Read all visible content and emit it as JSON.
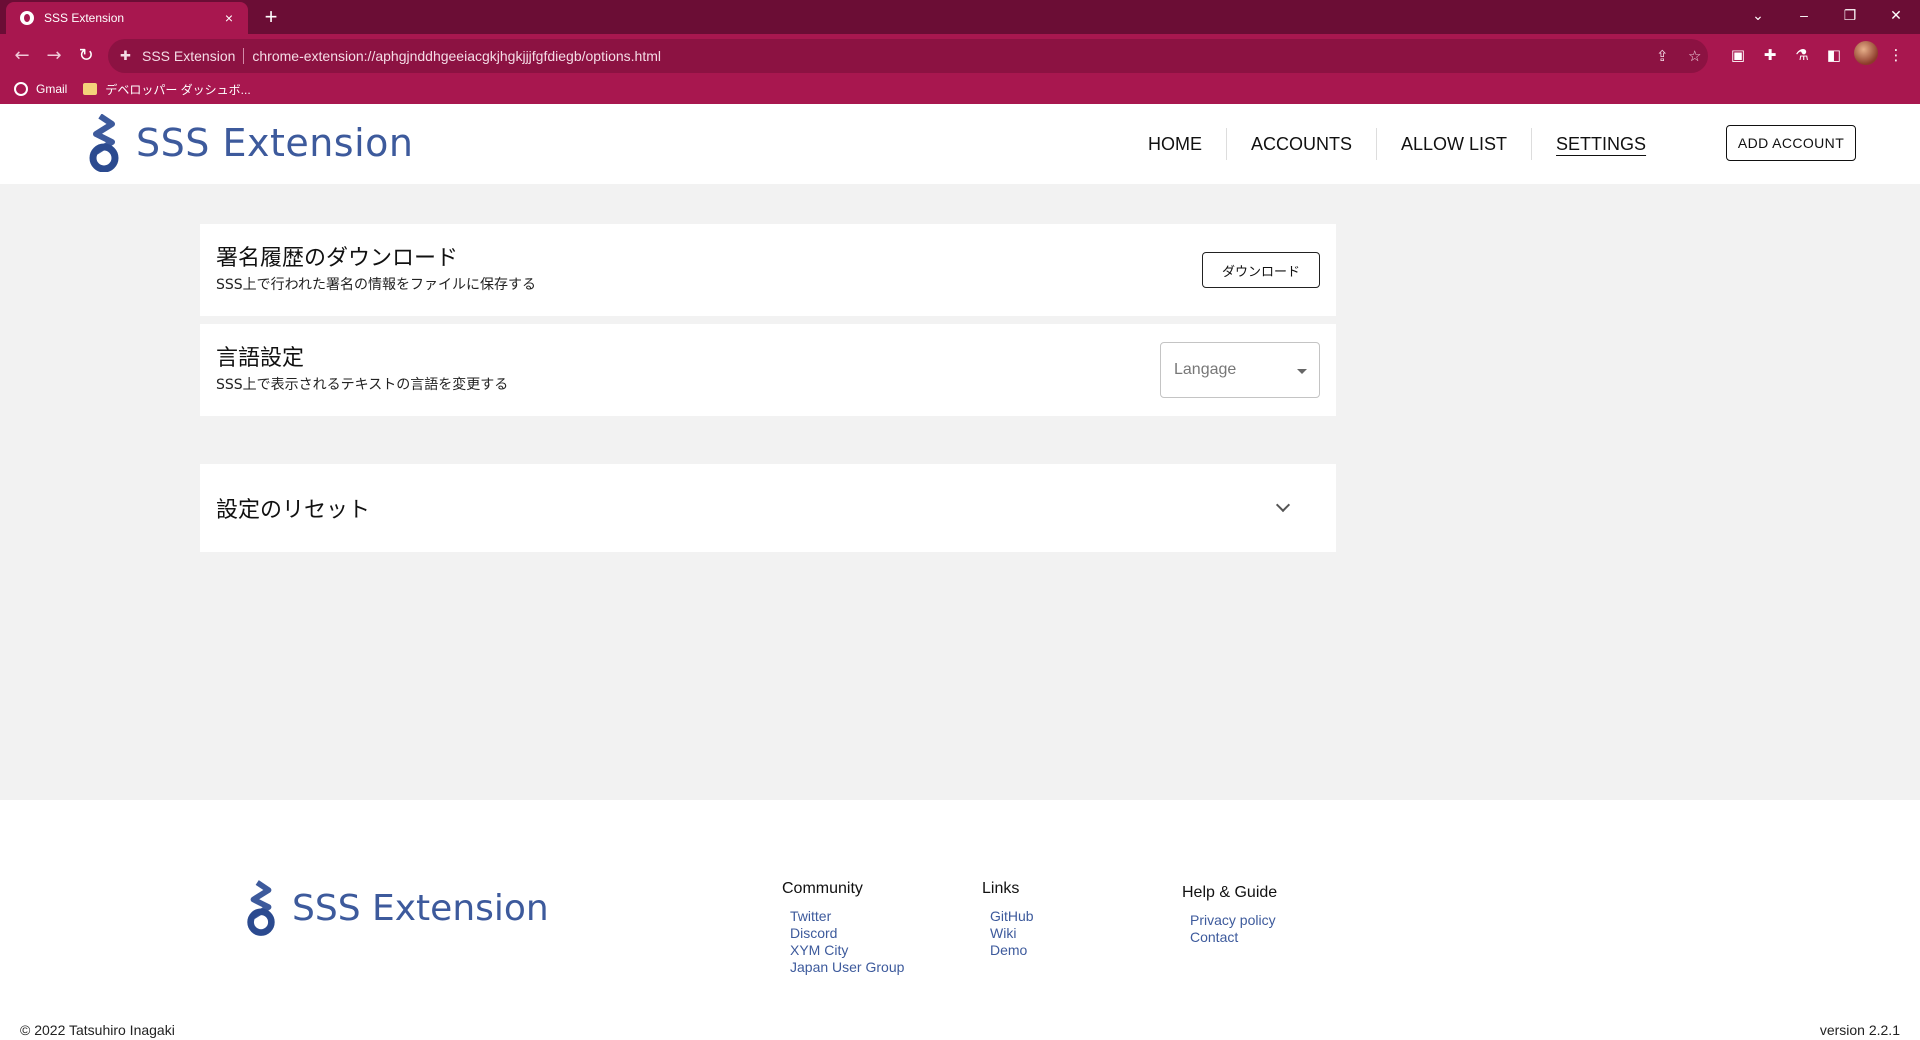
{
  "browser": {
    "tab_title": "SSS Extension",
    "tab_close": "×",
    "new_tab": "+",
    "site_label": "SSS Extension",
    "url": "chrome-extension://aphgjnddhgeeiacgkjhgkjjjfgfdiegb/options.html",
    "bookmarks": [
      {
        "label": "Gmail",
        "icon": "globe-icon"
      },
      {
        "label": "デベロッパー ダッシュボ...",
        "icon": "folder-icon"
      }
    ],
    "colors": {
      "tabstrip": "#6b0d35",
      "toolbar": "#a8174f"
    }
  },
  "header": {
    "brand": "SSS Extension",
    "nav": [
      {
        "label": "HOME",
        "active": false
      },
      {
        "label": "ACCOUNTS",
        "active": false
      },
      {
        "label": "ALLOW LIST",
        "active": false
      },
      {
        "label": "SETTINGS",
        "active": true
      }
    ],
    "add_account_label": "ADD ACCOUNT"
  },
  "settings": {
    "download": {
      "title": "署名履歴のダウンロード",
      "description": "SSS上で行われた署名の情報をファイルに保存する",
      "button_label": "ダウンロード"
    },
    "language": {
      "title": "言語設定",
      "description": "SSS上で表示されるテキストの言語を変更する",
      "select_placeholder": "Langage"
    },
    "reset": {
      "title": "設定のリセット"
    }
  },
  "footer": {
    "brand": "SSS Extension",
    "columns": [
      {
        "heading": "Community",
        "links": [
          "Twitter",
          "Discord",
          "XYM City",
          "Japan User Group"
        ]
      },
      {
        "heading": "Links",
        "links": [
          "GitHub",
          "Wiki",
          "Demo"
        ]
      },
      {
        "heading": "Help & Guide",
        "links": [
          "Privacy policy",
          "Contact"
        ]
      }
    ],
    "copyright": "© 2022 Tatsuhiro Inagaki",
    "version": "version 2.2.1"
  },
  "theme": {
    "brand_blue": "#3d5a9c",
    "page_bg": "#f2f2f2"
  }
}
